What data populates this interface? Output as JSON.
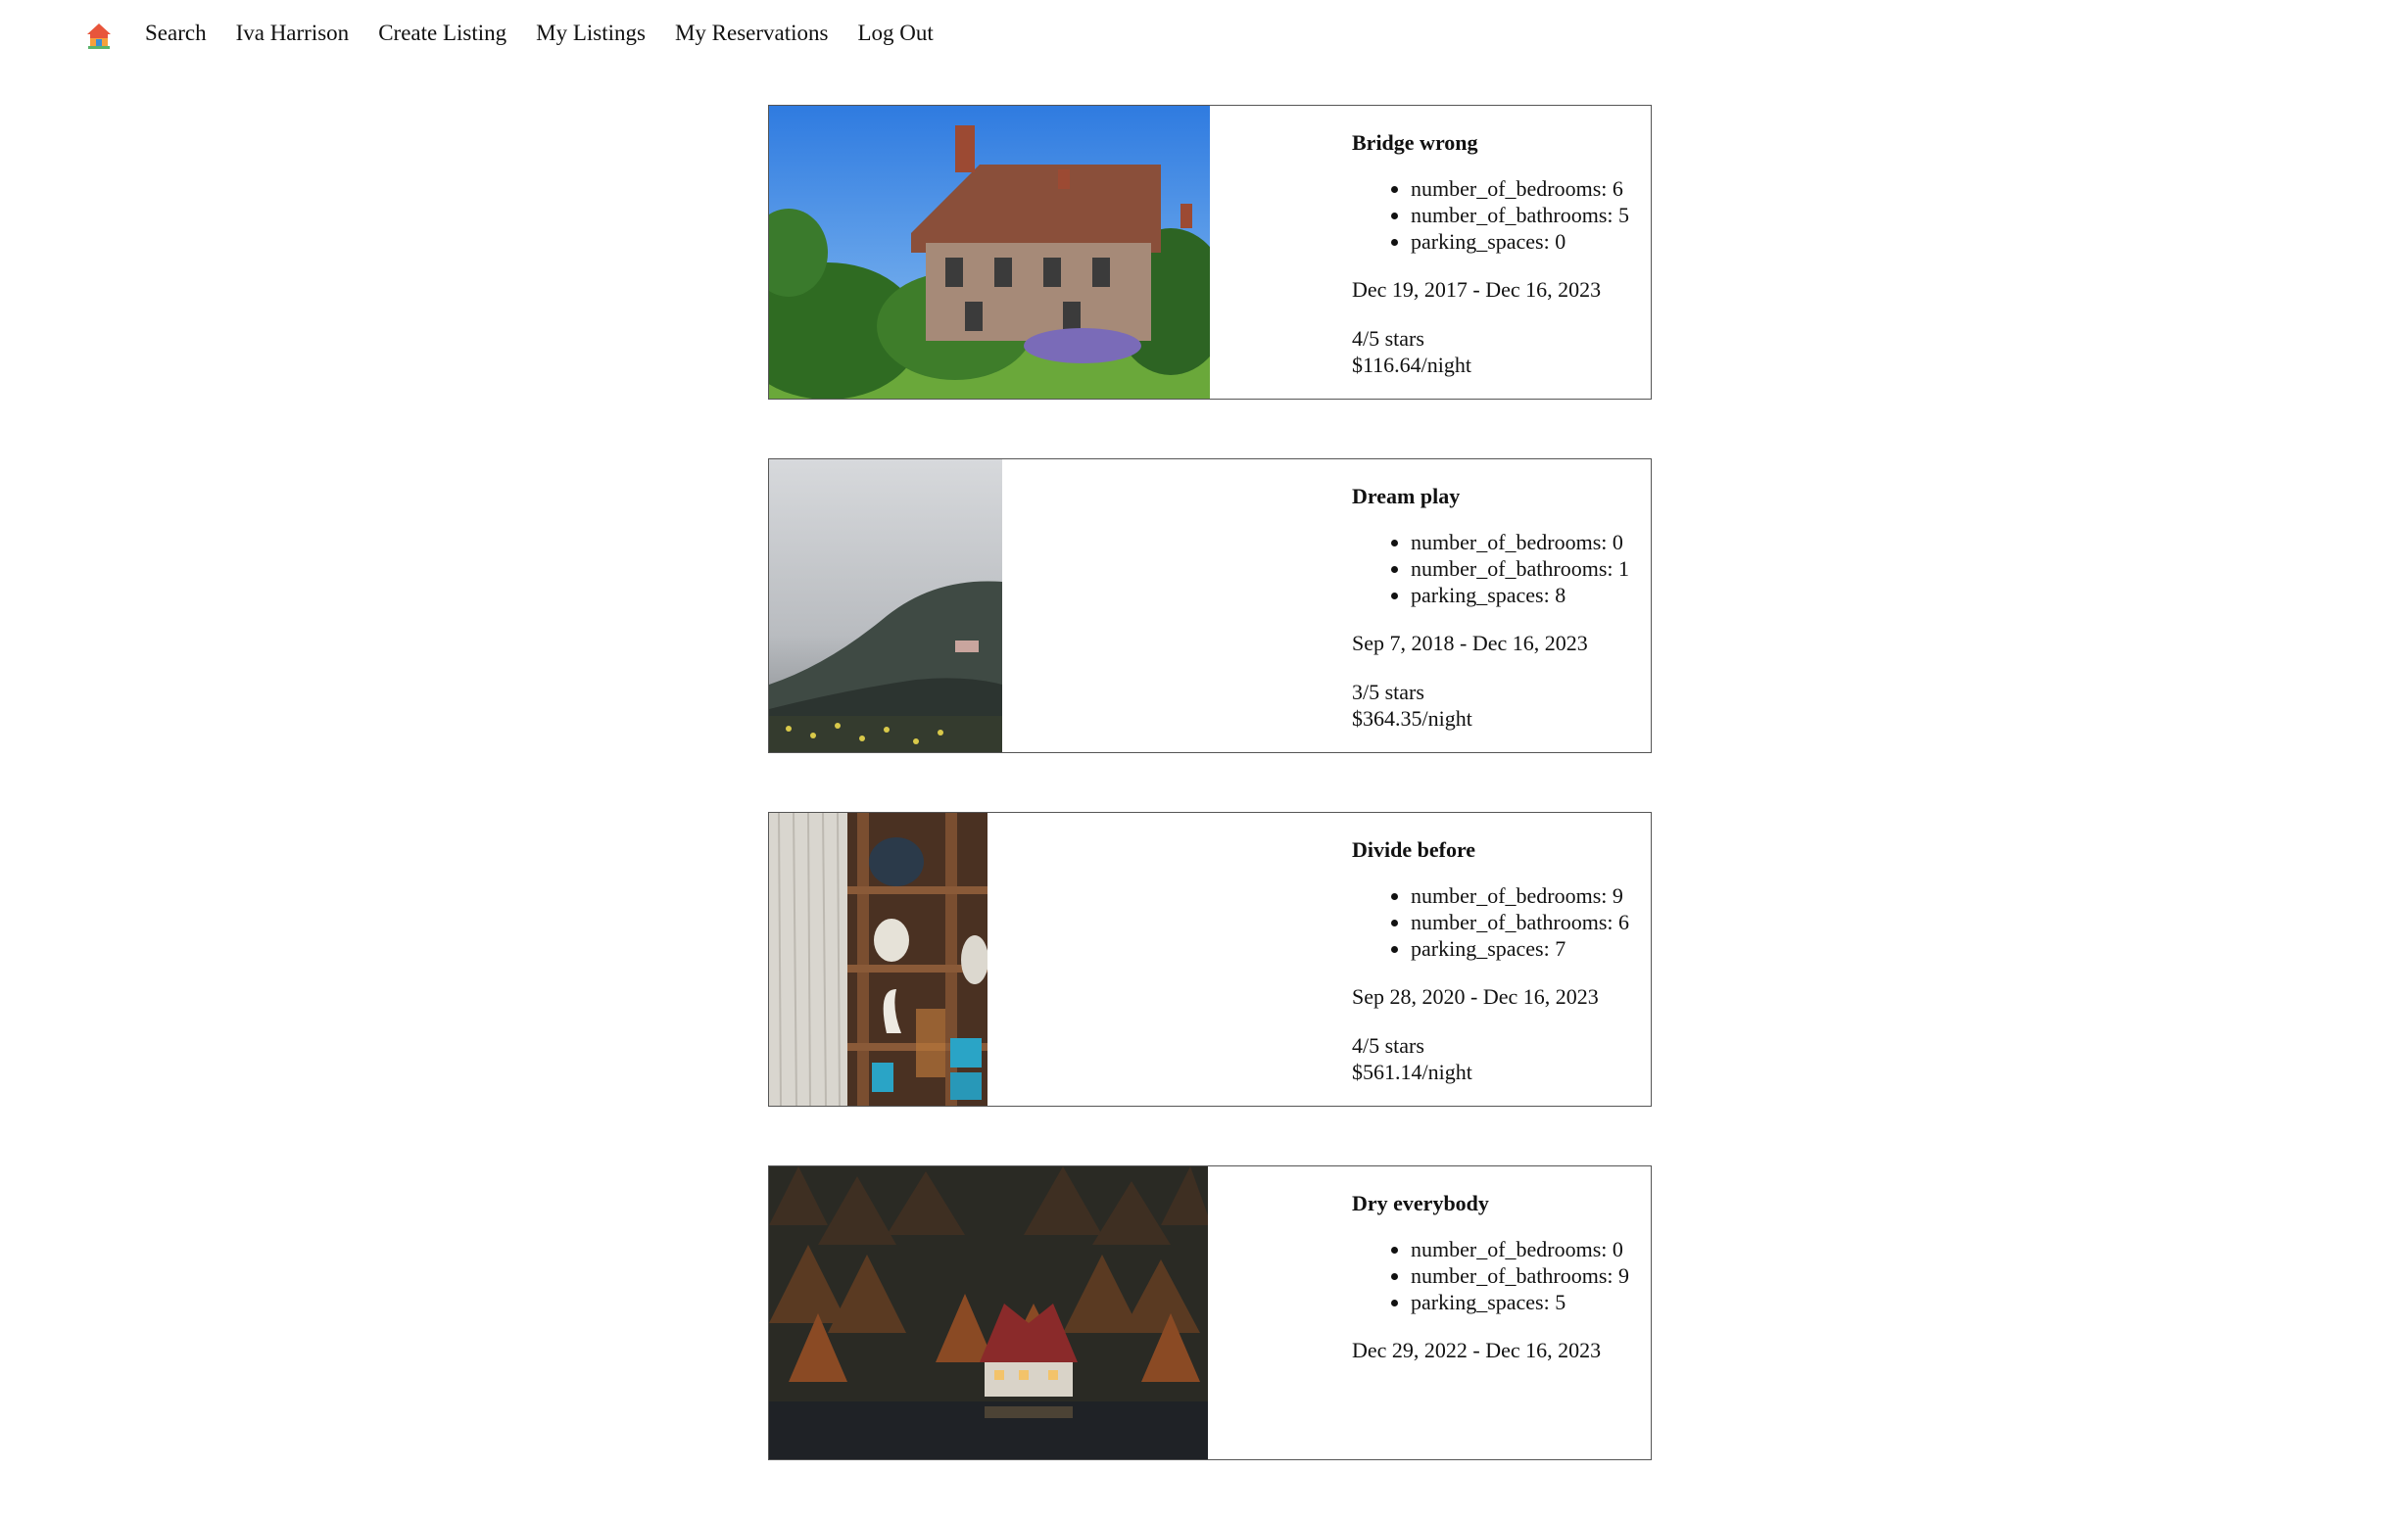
{
  "nav": {
    "home_icon": "house-icon",
    "links": [
      "Search",
      "Iva Harrison",
      "Create Listing",
      "My Listings",
      "My Reservations",
      "Log Out"
    ]
  },
  "listings": [
    {
      "title": "Bridge wrong",
      "attributes": [
        "number_of_bedrooms: 6",
        "number_of_bathrooms: 5",
        "parking_spaces: 0"
      ],
      "dates": "Dec 19, 2017 - Dec 16, 2023",
      "rating": "4/5 stars",
      "price": "$116.64/night",
      "image": "cottage-photo"
    },
    {
      "title": "Dream play",
      "attributes": [
        "number_of_bedrooms: 0",
        "number_of_bathrooms: 1",
        "parking_spaces: 8"
      ],
      "dates": "Sep 7, 2018 - Dec 16, 2023",
      "rating": "3/5 stars",
      "price": "$364.35/night",
      "image": "foggy-coast-photo"
    },
    {
      "title": "Divide before",
      "attributes": [
        "number_of_bedrooms: 9",
        "number_of_bathrooms: 6",
        "parking_spaces: 7"
      ],
      "dates": "Sep 28, 2020 - Dec 16, 2023",
      "rating": "4/5 stars",
      "price": "$561.14/night",
      "image": "interior-shelves-photo"
    },
    {
      "title": "Dry everybody",
      "attributes": [
        "number_of_bedrooms: 0",
        "number_of_bathrooms: 9",
        "parking_spaces: 5"
      ],
      "dates": "Dec 29, 2022 - Dec 16, 2023",
      "rating": "",
      "price": "",
      "image": "forest-house-photo"
    }
  ]
}
